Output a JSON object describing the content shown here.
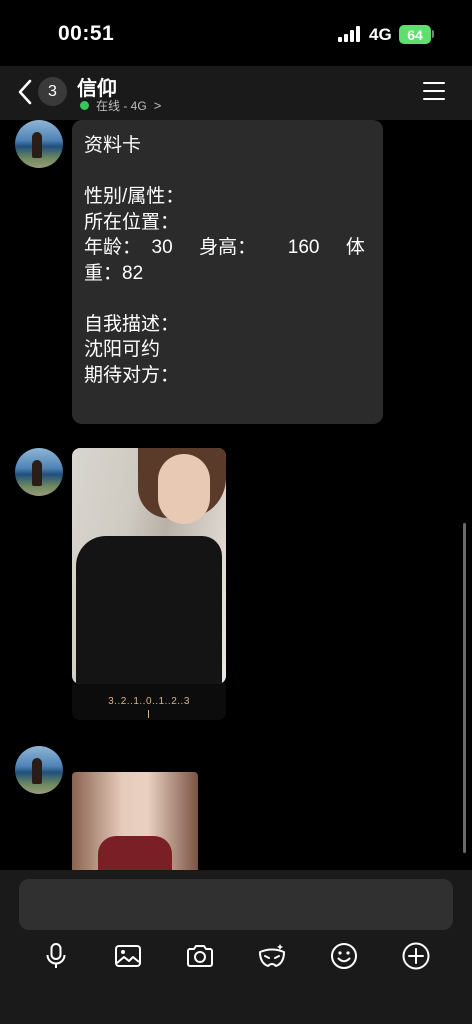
{
  "status_bar": {
    "time": "00:51",
    "network": "4G",
    "battery": "64"
  },
  "header": {
    "unread_count": "3",
    "title": "信仰",
    "presence": "在线 - 4G"
  },
  "messages": {
    "profile_card": {
      "line1": "资料卡",
      "line2": "性别/属性：",
      "line3": "所在位置：",
      "line4": "年龄：  30     身高：      160     体",
      "line5": "重：82",
      "line6": "自我描述：",
      "line7": "沈阳可约",
      "line8": "期待对方："
    },
    "scale_ticks": "3..2..1..0..1..2..3"
  },
  "toolbar": {
    "icons": [
      "microphone-icon",
      "image-icon",
      "camera-icon",
      "mask-icon",
      "emoji-icon",
      "plus-icon"
    ]
  },
  "colors": {
    "online": "#34c759",
    "battery": "#5ee06f",
    "bubble": "#2b2b2b",
    "bar": "#1a1a1a"
  }
}
